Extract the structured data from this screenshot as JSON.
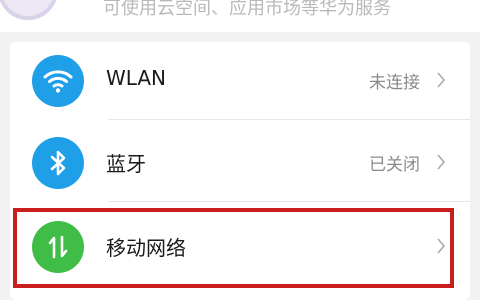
{
  "account": {
    "subtitle": "可使用云空间、应用市场等华为服务"
  },
  "settings": {
    "items": [
      {
        "label": "WLAN",
        "status": "未连接",
        "icon": "wifi-icon",
        "color": "#1e9fe8"
      },
      {
        "label": "蓝牙",
        "status": "已关闭",
        "icon": "bluetooth-icon",
        "color": "#1e9fe8"
      },
      {
        "label": "移动网络",
        "status": "",
        "icon": "mobile-data-icon",
        "color": "#3fbd47"
      }
    ]
  },
  "colors": {
    "highlight": "#c81e1e",
    "accent_blue": "#1e9fe8",
    "accent_green": "#3fbd47"
  }
}
